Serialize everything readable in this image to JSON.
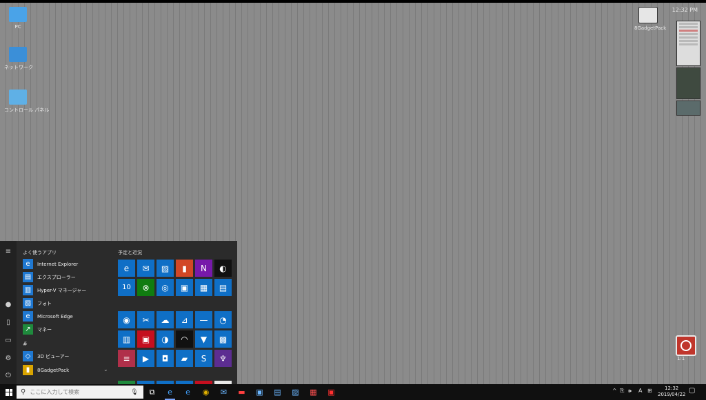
{
  "desktop": {
    "icons": [
      {
        "label": "PC",
        "color": "#4aa3e8"
      },
      {
        "label": "ネットワーク",
        "color": "#3b8fd8"
      },
      {
        "label": "コントロール パネル",
        "color": "#5fb0e6"
      }
    ],
    "right_icon_label": "8GadgetPack",
    "clock_text": "12:32 PM",
    "power_gadget_label": "1:1"
  },
  "start_menu": {
    "apps_header": "よく使うアプリ",
    "tiles_header": "予定と近況",
    "apps": [
      {
        "label": "Internet Explorer",
        "icon": "internet-explorer-icon",
        "color": "#1f78d1",
        "glyph": "e"
      },
      {
        "label": "エクスプローラー",
        "icon": "file-explorer-icon",
        "color": "#1f78d1",
        "glyph": "▤"
      },
      {
        "label": "Hyper-V マネージャー",
        "icon": "hyper-v-icon",
        "color": "#1f78d1",
        "glyph": "▥"
      },
      {
        "label": "フォト",
        "icon": "photos-icon",
        "color": "#1f78d1",
        "glyph": "▨"
      },
      {
        "label": "Microsoft Edge",
        "icon": "edge-icon",
        "color": "#1f78d1",
        "glyph": "e"
      },
      {
        "label": "マネー",
        "icon": "money-icon",
        "color": "#1f8a3d",
        "glyph": "↗"
      }
    ],
    "section_letter": "#",
    "apps_more": [
      {
        "label": "3D ビューアー",
        "icon": "3d-viewer-icon",
        "color": "#1f78d1",
        "glyph": "◇"
      },
      {
        "label": "8GadgetPack",
        "icon": "gadgetpack-icon",
        "color": "#d9a400",
        "glyph": "▮"
      }
    ],
    "expand_glyph": "⌄",
    "tiles": [
      {
        "name": "edge-tile",
        "color": "#0f6fc6",
        "glyph": "e"
      },
      {
        "name": "mail-tile",
        "color": "#0f6fc6",
        "glyph": "✉"
      },
      {
        "name": "photos-tile",
        "color": "#0f6fc6",
        "glyph": "▨"
      },
      {
        "name": "office-tile",
        "color": "#d24726",
        "glyph": "▮"
      },
      {
        "name": "onenote-tile",
        "color": "#7719aa",
        "glyph": "N"
      },
      {
        "name": "maps-tile",
        "color": "#111111",
        "glyph": "◐"
      },
      {
        "name": "calendar-tile",
        "color": "#0f6fc6",
        "glyph": "10"
      },
      {
        "name": "xbox-tile",
        "color": "#107c10",
        "glyph": "⊗"
      },
      {
        "name": "groove-tile",
        "color": "#0f6fc6",
        "glyph": "◎"
      },
      {
        "name": "store-tile",
        "color": "#0f6fc6",
        "glyph": "▣"
      },
      {
        "name": "paint3d-tile",
        "color": "#0f6fc6",
        "glyph": "▦"
      },
      {
        "name": "sticky-tile",
        "color": "#0f6fc6",
        "glyph": "▤"
      },
      {
        "name": "camera-tile",
        "color": "#0f6fc6",
        "glyph": "◉"
      },
      {
        "name": "snip-tile",
        "color": "#0f6fc6",
        "glyph": "✂"
      },
      {
        "name": "weather-tile",
        "color": "#0f6fc6",
        "glyph": "☁"
      },
      {
        "name": "remote-tile",
        "color": "#0f6fc6",
        "glyph": "⊿"
      },
      {
        "name": "connect-tile",
        "color": "#0f6fc6",
        "glyph": "—"
      },
      {
        "name": "alarms-tile",
        "color": "#0f6fc6",
        "glyph": "◔"
      },
      {
        "name": "calculator-tile",
        "color": "#0f6fc6",
        "glyph": "▥"
      },
      {
        "name": "feedback-tile",
        "color": "#c50f1f",
        "glyph": "▣"
      },
      {
        "name": "voice-tile",
        "color": "#0f6fc6",
        "glyph": "◑"
      },
      {
        "name": "speedtest-tile",
        "color": "#111111",
        "glyph": "◠"
      },
      {
        "name": "vpn-tile",
        "color": "#0f6fc6",
        "glyph": "▼"
      },
      {
        "name": "news-tile",
        "color": "#0f6fc6",
        "glyph": "▩"
      },
      {
        "name": "reader-tile",
        "color": "#b0304a",
        "glyph": "≡"
      },
      {
        "name": "movies-tile",
        "color": "#0f6fc6",
        "glyph": "▶"
      },
      {
        "name": "media-tile",
        "color": "#0f6fc6",
        "glyph": "◘"
      },
      {
        "name": "briefcase-tile",
        "color": "#0f6fc6",
        "glyph": "▰"
      },
      {
        "name": "skype-tile",
        "color": "#0f6fc6",
        "glyph": "S"
      },
      {
        "name": "trophy-tile",
        "color": "#5c2d91",
        "glyph": "♆"
      }
    ],
    "rail_icons": [
      "hamburger-icon",
      "user-icon",
      "document-icon",
      "pictures-icon",
      "settings-icon",
      "power-icon"
    ],
    "rail_glyphs": [
      "≡",
      "●",
      "▯",
      "▭",
      "⚙",
      "⏻"
    ]
  },
  "taskbar": {
    "search_placeholder": "ここに入力して検索",
    "search_glyph": "⚲",
    "mic_glyph": "🎙",
    "items": [
      {
        "name": "task-view-icon",
        "glyph": "⧉",
        "color": "#ffffff"
      },
      {
        "name": "edge-taskbar-icon",
        "glyph": "e",
        "color": "#4aa8ff"
      },
      {
        "name": "ie-taskbar-icon",
        "glyph": "e",
        "color": "#3fa0ff"
      },
      {
        "name": "chrome-taskbar-icon",
        "glyph": "◉",
        "color": "#e0b000"
      },
      {
        "name": "mail-taskbar-icon",
        "glyph": "✉",
        "color": "#6bb6ff"
      },
      {
        "name": "app-red-taskbar-icon",
        "glyph": "▬",
        "color": "#ff4040"
      },
      {
        "name": "store-taskbar-icon",
        "glyph": "▣",
        "color": "#6bb6ff"
      },
      {
        "name": "network-taskbar-icon",
        "glyph": "▤",
        "color": "#6bb6ff"
      },
      {
        "name": "photos-taskbar-icon",
        "glyph": "▨",
        "color": "#6bb6ff"
      },
      {
        "name": "calendar-taskbar-icon",
        "glyph": "▦",
        "color": "#ff5050"
      },
      {
        "name": "video-taskbar-icon",
        "glyph": "▣",
        "color": "#ff3030"
      }
    ],
    "tray": [
      "^",
      "⎘",
      "🕪",
      "A",
      "⊞"
    ],
    "time": "12:32",
    "date": "2019/04/22",
    "notification_glyph": "▢"
  }
}
